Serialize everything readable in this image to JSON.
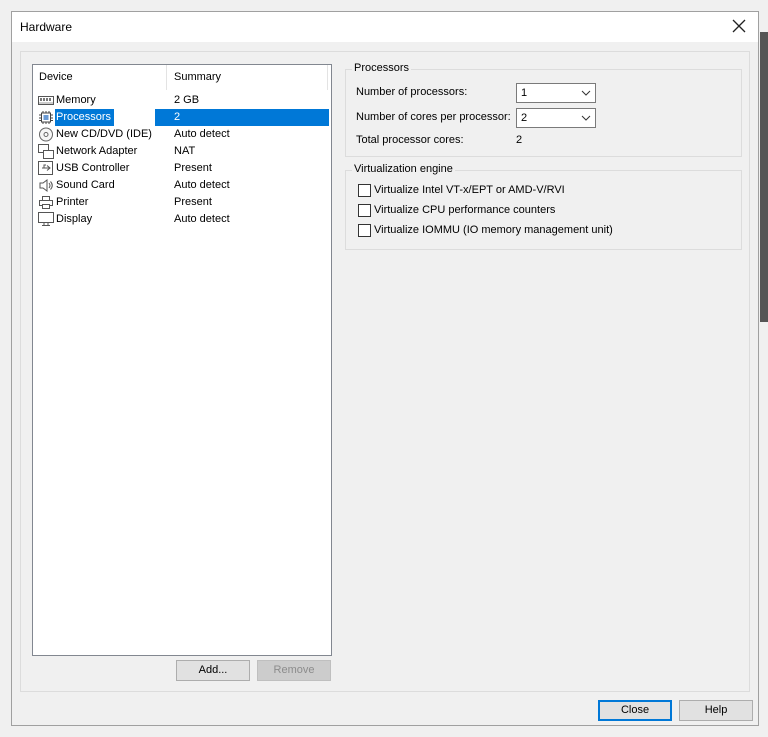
{
  "window": {
    "title": "Hardware"
  },
  "device_list": {
    "columns": [
      "Device",
      "Summary"
    ],
    "rows": [
      {
        "name": "Memory",
        "summary": "2 GB",
        "icon": "memory-icon"
      },
      {
        "name": "Processors",
        "summary": "2",
        "icon": "processor-icon",
        "selected": true
      },
      {
        "name": "New CD/DVD (IDE)",
        "summary": "Auto detect",
        "icon": "cd-dvd-icon"
      },
      {
        "name": "Network Adapter",
        "summary": "NAT",
        "icon": "network-adapter-icon"
      },
      {
        "name": "USB Controller",
        "summary": "Present",
        "icon": "usb-icon"
      },
      {
        "name": "Sound Card",
        "summary": "Auto detect",
        "icon": "speaker-icon"
      },
      {
        "name": "Printer",
        "summary": "Present",
        "icon": "printer-icon"
      },
      {
        "name": "Display",
        "summary": "Auto detect",
        "icon": "monitor-icon"
      }
    ]
  },
  "buttons": {
    "add": "Add...",
    "remove": "Remove",
    "close": "Close",
    "help": "Help"
  },
  "processors": {
    "legend": "Processors",
    "num_processors_label": "Number of processors:",
    "num_processors_value": "1",
    "cores_label": "Number of cores per processor:",
    "cores_value": "2",
    "total_label": "Total processor cores:",
    "total_value": "2"
  },
  "virtualization": {
    "legend": "Virtualization engine",
    "options": [
      {
        "label": "Virtualize Intel VT-x/EPT or AMD-V/RVI",
        "checked": false
      },
      {
        "label": "Virtualize CPU performance counters",
        "checked": false
      },
      {
        "label": "Virtualize IOMMU (IO memory management unit)",
        "checked": false
      }
    ]
  },
  "colors": {
    "selection": "#0078d7",
    "window_bg": "#f0f0f0",
    "default_button_border": "#0078d7"
  }
}
